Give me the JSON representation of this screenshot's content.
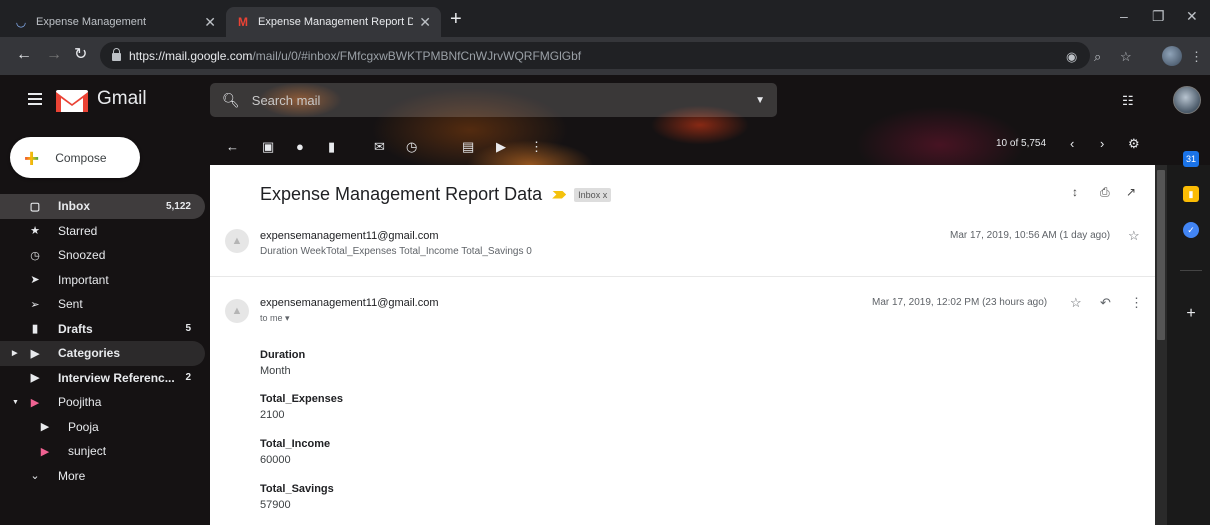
{
  "browser": {
    "tabs": [
      {
        "title": "Expense Management",
        "active": false
      },
      {
        "title": "Expense Management Report Dat",
        "active": true
      }
    ],
    "new_tab_glyph": "+",
    "url_host": "https://mail.google.com",
    "url_path": "/mail/u/0/#inbox/FMfcgxwBWKTPMBNfCnWJrvWQRFMGlGbf"
  },
  "gmail": {
    "product_name": "Gmail",
    "search_placeholder": "Search mail",
    "compose_label": "Compose",
    "nav": [
      {
        "icon": "inbox-icon",
        "label": "Inbox",
        "count": "5,122",
        "active": true
      },
      {
        "icon": "star-icon",
        "label": "Starred",
        "count": ""
      },
      {
        "icon": "clock-icon",
        "label": "Snoozed",
        "count": ""
      },
      {
        "icon": "important-icon",
        "label": "Important",
        "count": ""
      },
      {
        "icon": "send-icon",
        "label": "Sent",
        "count": ""
      },
      {
        "icon": "draft-icon",
        "label": "Drafts",
        "count": "5",
        "bold": true
      },
      {
        "icon": "label-icon",
        "label": "Categories",
        "count": ""
      },
      {
        "icon": "label-icon",
        "label": "Interview Referenc...",
        "count": "2",
        "bold": true
      },
      {
        "icon": "label-icon",
        "label": "Poojitha",
        "count": ""
      },
      {
        "icon": "label-icon",
        "label": "Pooja",
        "count": ""
      },
      {
        "icon": "label-icon",
        "label": "sunject",
        "count": ""
      },
      {
        "icon": "chevron-down-icon",
        "label": "More",
        "count": ""
      }
    ],
    "pager": {
      "text": "10 of 5,754"
    },
    "email": {
      "subject": "Expense Management Report Data",
      "label": "Inbox x",
      "messages": [
        {
          "sender": "expensemanagement11@gmail.com",
          "snippet": "Duration WeekTotal_Expenses Total_Income Total_Savings 0",
          "date": "Mar 17, 2019, 10:56 AM (1 day ago)"
        },
        {
          "sender": "expensemanagement11@gmail.com",
          "to": "to me ▾",
          "date": "Mar 17, 2019, 12:02 PM (23 hours ago)",
          "fields": [
            {
              "label": "Duration",
              "value": "Month"
            },
            {
              "label": "Total_Expenses",
              "value": "2100"
            },
            {
              "label": "Total_Income",
              "value": "60000"
            },
            {
              "label": "Total_Savings",
              "value": "57900"
            }
          ]
        }
      ]
    }
  },
  "colors": {
    "gmail_red": "#ea4335",
    "important_yellow": "#f4c20d",
    "calendar_blue": "#1a73e8",
    "keep_yellow": "#fbbc04",
    "tasks_blue": "#4285f4",
    "label_pink": "#f06292"
  }
}
